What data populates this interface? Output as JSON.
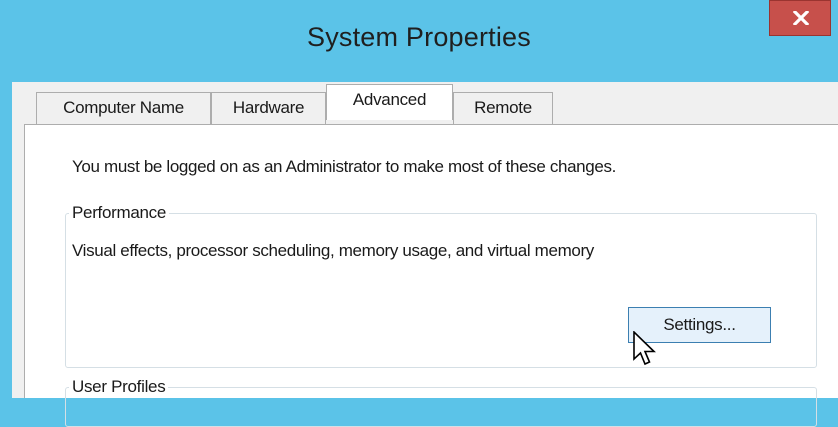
{
  "window": {
    "title": "System Properties",
    "close_label": "x"
  },
  "tabs": [
    {
      "label": "Computer Name",
      "active": false
    },
    {
      "label": "Hardware",
      "active": false
    },
    {
      "label": "Advanced",
      "active": true
    },
    {
      "label": "Remote",
      "active": false
    }
  ],
  "advanced": {
    "admin_notice": "You must be logged on as an Administrator to make most of these changes.",
    "performance": {
      "group_label": "Performance",
      "description": "Visual effects, processor scheduling, memory usage, and virtual memory",
      "settings_label": "Settings..."
    },
    "user_profiles": {
      "group_label": "User Profiles"
    }
  },
  "colors": {
    "titlebar": "#5bc3e8",
    "close_button": "#c7504b",
    "settings_button_border": "#3c7fb1",
    "settings_button_fill": "#e5f1fb"
  },
  "icons": {
    "close": "close-icon",
    "pointer": "mouse-pointer-icon"
  }
}
